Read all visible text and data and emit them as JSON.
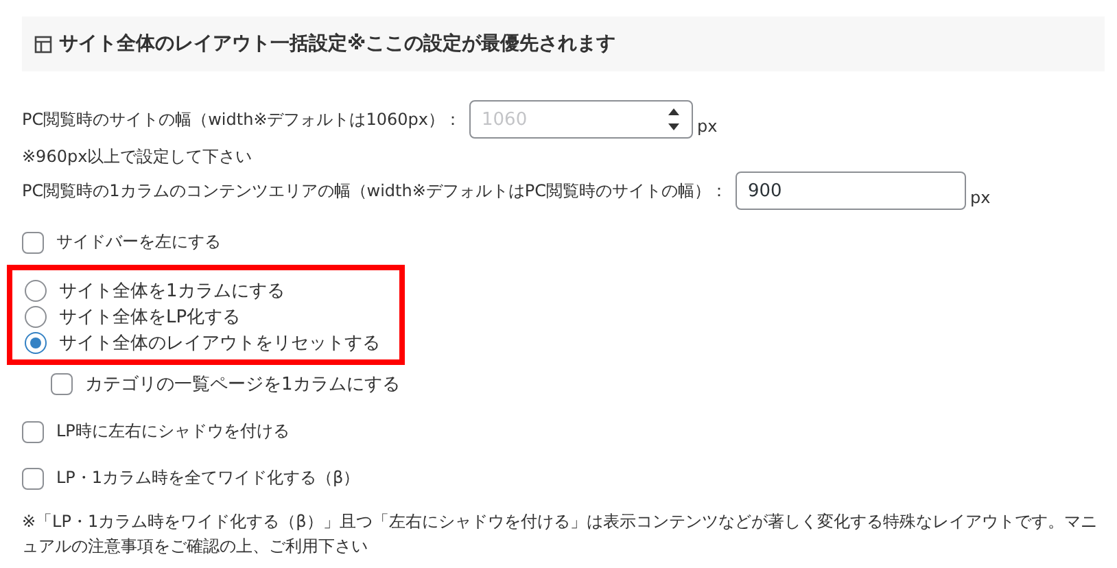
{
  "section": {
    "title": "サイト全体のレイアウト一括設定※ここの設定が最優先されます"
  },
  "fields": [
    {
      "label": "PC閲覧時のサイトの幅（width※デフォルトは1060px）：",
      "kind": "number",
      "placeholder": "1060",
      "unit": "px",
      "note": "※960px以上で設定して下さい"
    },
    {
      "label": "PC閲覧時の1カラムのコンテンツエリアの幅（width※デフォルトはPC閲覧時のサイトの幅）：",
      "kind": "text",
      "value": "900",
      "unit": "px"
    }
  ],
  "sidebar_option": {
    "label": "サイドバーを左にする",
    "checked": false
  },
  "layout_options": [
    {
      "label": "サイト全体を1カラムにする",
      "selected": false
    },
    {
      "label": "サイト全体をLP化する",
      "selected": false
    },
    {
      "label": "サイト全体のレイアウトをリセットする",
      "selected": true
    }
  ],
  "category_option": {
    "label": "カテゴリの一覧ページを1カラムにする",
    "checked": false
  },
  "options": [
    {
      "label": "LP時に左右にシャドウを付ける",
      "checked": false
    },
    {
      "label": "LP・1カラム時を全てワイド化する（β）",
      "checked": false
    }
  ],
  "footnote": "※「LP・1カラム時をワイド化する（β）」且つ「左右にシャドウを付ける」は表示コンテンツなどが著しく変化する特殊なレイアウトです。マニュアルの注意事項をご確認の上、ご利用下さい"
}
